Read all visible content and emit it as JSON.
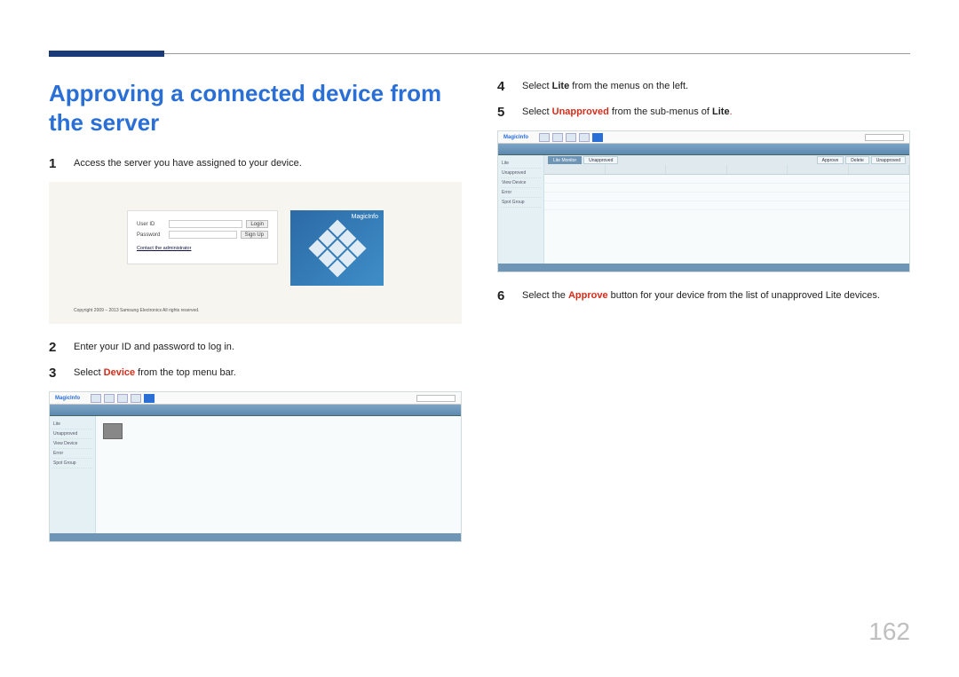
{
  "page_number": "162",
  "title": "Approving a connected device from the server",
  "steps": {
    "s1": {
      "num": "1",
      "text": "Access the server you have assigned to your device."
    },
    "s2": {
      "num": "2",
      "text": "Enter your ID and password to log in."
    },
    "s3": {
      "num": "3",
      "pre": "Select ",
      "hl": "Device",
      "post": " from the top menu bar."
    },
    "s4": {
      "num": "4",
      "pre": "Select ",
      "hl": "Lite",
      "post": " from the menus on the left."
    },
    "s5": {
      "num": "5",
      "pre": "Select ",
      "hl": "Unapproved",
      "post_a": " from the sub-menus of ",
      "hl2": "Lite",
      "post_b": "."
    },
    "s6": {
      "num": "6",
      "pre": "Select the ",
      "hl": "Approve",
      "post": " button for your device from the list of unapproved Lite devices."
    }
  },
  "login": {
    "user_label": "User ID",
    "pass_label": "Password",
    "login_btn": "Login",
    "signup_btn": "Sign Up",
    "contact": "Contact the administrator",
    "brand": "MagicInfo",
    "copyright": "Copyright 2009 – 2013 Samsung Electronics All rights reserved."
  },
  "app": {
    "logo": "MagicInfo",
    "sidebar": [
      "Lite",
      "Unapproved",
      "View Device",
      "Error",
      "Spot Group"
    ],
    "tabs": {
      "lite_monitor": "Lite Monitor",
      "unapproved": "Unapproved",
      "approve": "Approve",
      "delete": "Delete",
      "unapproved2": "Unapproved"
    }
  }
}
